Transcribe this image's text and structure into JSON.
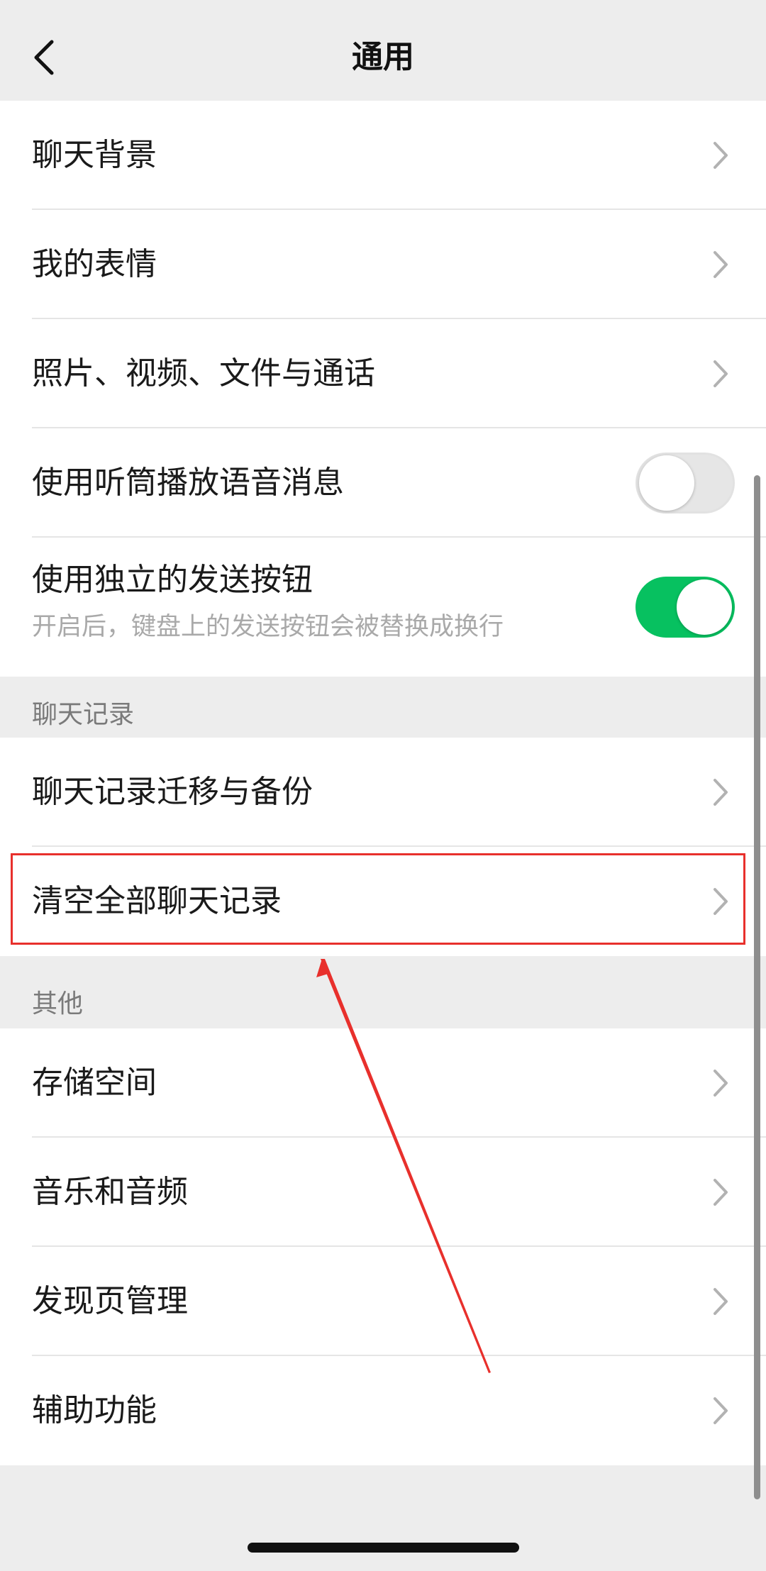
{
  "navbar": {
    "title": "通用",
    "back_icon": "chevron-left-icon"
  },
  "group_top": {
    "items": [
      {
        "label": "聊天背景",
        "control": "chevron"
      },
      {
        "label": "我的表情",
        "control": "chevron"
      },
      {
        "label": "照片、视频、文件与通话",
        "control": "chevron"
      },
      {
        "label": "使用听筒播放语音消息",
        "control": "toggle",
        "toggle_state": "off"
      },
      {
        "label": "使用独立的发送按钮",
        "sublabel": "开启后，键盘上的发送按钮会被替换成换行",
        "control": "toggle",
        "toggle_state": "on"
      }
    ]
  },
  "section_chat": {
    "header": "聊天记录",
    "items": [
      {
        "label": "聊天记录迁移与备份",
        "control": "chevron"
      },
      {
        "label": "清空全部聊天记录",
        "control": "chevron",
        "highlighted": true
      }
    ]
  },
  "section_other": {
    "header": "其他",
    "items": [
      {
        "label": "存储空间",
        "control": "chevron"
      },
      {
        "label": "音乐和音频",
        "control": "chevron"
      },
      {
        "label": "发现页管理",
        "control": "chevron"
      },
      {
        "label": "辅助功能",
        "control": "chevron"
      }
    ]
  },
  "colors": {
    "accent_green": "#07c160",
    "annotation_red": "#e8302c",
    "background": "#ededed"
  }
}
